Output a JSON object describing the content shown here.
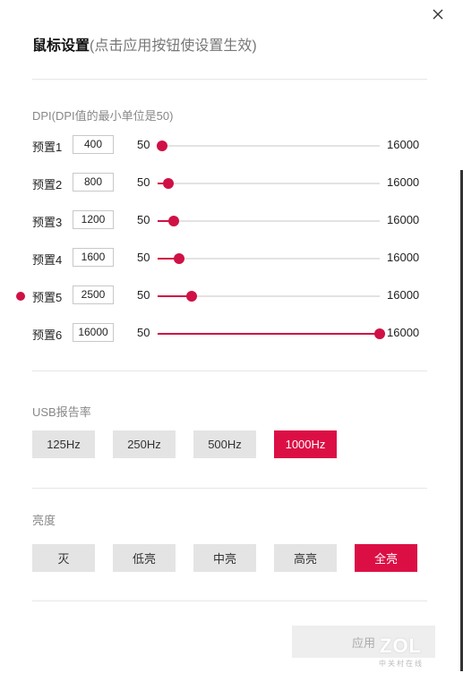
{
  "dialog": {
    "title": "鼠标设置",
    "subtitle": "(点击应用按钮使设置生效)",
    "close_icon": "close-icon"
  },
  "dpi": {
    "label": "DPI(DPI值的最小单位是50)",
    "min": "50",
    "max": "16000",
    "accent_color": "#cf1145",
    "active_preset": 5,
    "presets": [
      {
        "name": "预置1",
        "value": "400",
        "min": "50",
        "max": "16000",
        "level": 400
      },
      {
        "name": "预置2",
        "value": "800",
        "min": "50",
        "max": "16000",
        "level": 800
      },
      {
        "name": "预置3",
        "value": "1200",
        "min": "50",
        "max": "16000",
        "level": 1200
      },
      {
        "name": "预置4",
        "value": "1600",
        "min": "50",
        "max": "16000",
        "level": 1600
      },
      {
        "name": "预置5",
        "value": "2500",
        "min": "50",
        "max": "16000",
        "level": 2500
      },
      {
        "name": "预置6",
        "value": "16000",
        "min": "50",
        "max": "16000",
        "level": 16000
      }
    ]
  },
  "usb": {
    "label": "USB报告率",
    "options": [
      "125Hz",
      "250Hz",
      "500Hz",
      "1000Hz"
    ],
    "selected": "1000Hz"
  },
  "brightness": {
    "label": "亮度",
    "options": [
      "灭",
      "低亮",
      "中亮",
      "高亮",
      "全亮"
    ],
    "selected": "全亮"
  },
  "footer": {
    "apply_label": "应用",
    "watermark": "ZOL",
    "watermark_sub": "中关村在线"
  }
}
